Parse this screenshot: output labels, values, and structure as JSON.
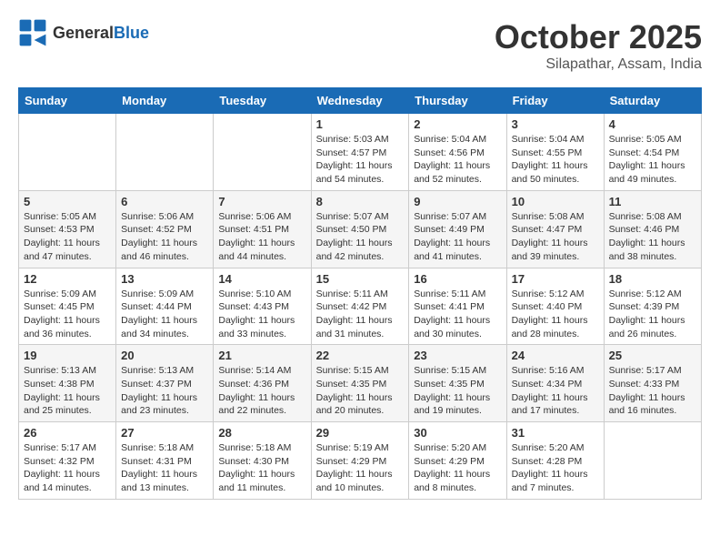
{
  "header": {
    "logo_general": "General",
    "logo_blue": "Blue",
    "month": "October 2025",
    "location": "Silapathar, Assam, India"
  },
  "weekdays": [
    "Sunday",
    "Monday",
    "Tuesday",
    "Wednesday",
    "Thursday",
    "Friday",
    "Saturday"
  ],
  "weeks": [
    [
      {
        "day": "",
        "info": ""
      },
      {
        "day": "",
        "info": ""
      },
      {
        "day": "",
        "info": ""
      },
      {
        "day": "1",
        "info": "Sunrise: 5:03 AM\nSunset: 4:57 PM\nDaylight: 11 hours\nand 54 minutes."
      },
      {
        "day": "2",
        "info": "Sunrise: 5:04 AM\nSunset: 4:56 PM\nDaylight: 11 hours\nand 52 minutes."
      },
      {
        "day": "3",
        "info": "Sunrise: 5:04 AM\nSunset: 4:55 PM\nDaylight: 11 hours\nand 50 minutes."
      },
      {
        "day": "4",
        "info": "Sunrise: 5:05 AM\nSunset: 4:54 PM\nDaylight: 11 hours\nand 49 minutes."
      }
    ],
    [
      {
        "day": "5",
        "info": "Sunrise: 5:05 AM\nSunset: 4:53 PM\nDaylight: 11 hours\nand 47 minutes."
      },
      {
        "day": "6",
        "info": "Sunrise: 5:06 AM\nSunset: 4:52 PM\nDaylight: 11 hours\nand 46 minutes."
      },
      {
        "day": "7",
        "info": "Sunrise: 5:06 AM\nSunset: 4:51 PM\nDaylight: 11 hours\nand 44 minutes."
      },
      {
        "day": "8",
        "info": "Sunrise: 5:07 AM\nSunset: 4:50 PM\nDaylight: 11 hours\nand 42 minutes."
      },
      {
        "day": "9",
        "info": "Sunrise: 5:07 AM\nSunset: 4:49 PM\nDaylight: 11 hours\nand 41 minutes."
      },
      {
        "day": "10",
        "info": "Sunrise: 5:08 AM\nSunset: 4:47 PM\nDaylight: 11 hours\nand 39 minutes."
      },
      {
        "day": "11",
        "info": "Sunrise: 5:08 AM\nSunset: 4:46 PM\nDaylight: 11 hours\nand 38 minutes."
      }
    ],
    [
      {
        "day": "12",
        "info": "Sunrise: 5:09 AM\nSunset: 4:45 PM\nDaylight: 11 hours\nand 36 minutes."
      },
      {
        "day": "13",
        "info": "Sunrise: 5:09 AM\nSunset: 4:44 PM\nDaylight: 11 hours\nand 34 minutes."
      },
      {
        "day": "14",
        "info": "Sunrise: 5:10 AM\nSunset: 4:43 PM\nDaylight: 11 hours\nand 33 minutes."
      },
      {
        "day": "15",
        "info": "Sunrise: 5:11 AM\nSunset: 4:42 PM\nDaylight: 11 hours\nand 31 minutes."
      },
      {
        "day": "16",
        "info": "Sunrise: 5:11 AM\nSunset: 4:41 PM\nDaylight: 11 hours\nand 30 minutes."
      },
      {
        "day": "17",
        "info": "Sunrise: 5:12 AM\nSunset: 4:40 PM\nDaylight: 11 hours\nand 28 minutes."
      },
      {
        "day": "18",
        "info": "Sunrise: 5:12 AM\nSunset: 4:39 PM\nDaylight: 11 hours\nand 26 minutes."
      }
    ],
    [
      {
        "day": "19",
        "info": "Sunrise: 5:13 AM\nSunset: 4:38 PM\nDaylight: 11 hours\nand 25 minutes."
      },
      {
        "day": "20",
        "info": "Sunrise: 5:13 AM\nSunset: 4:37 PM\nDaylight: 11 hours\nand 23 minutes."
      },
      {
        "day": "21",
        "info": "Sunrise: 5:14 AM\nSunset: 4:36 PM\nDaylight: 11 hours\nand 22 minutes."
      },
      {
        "day": "22",
        "info": "Sunrise: 5:15 AM\nSunset: 4:35 PM\nDaylight: 11 hours\nand 20 minutes."
      },
      {
        "day": "23",
        "info": "Sunrise: 5:15 AM\nSunset: 4:35 PM\nDaylight: 11 hours\nand 19 minutes."
      },
      {
        "day": "24",
        "info": "Sunrise: 5:16 AM\nSunset: 4:34 PM\nDaylight: 11 hours\nand 17 minutes."
      },
      {
        "day": "25",
        "info": "Sunrise: 5:17 AM\nSunset: 4:33 PM\nDaylight: 11 hours\nand 16 minutes."
      }
    ],
    [
      {
        "day": "26",
        "info": "Sunrise: 5:17 AM\nSunset: 4:32 PM\nDaylight: 11 hours\nand 14 minutes."
      },
      {
        "day": "27",
        "info": "Sunrise: 5:18 AM\nSunset: 4:31 PM\nDaylight: 11 hours\nand 13 minutes."
      },
      {
        "day": "28",
        "info": "Sunrise: 5:18 AM\nSunset: 4:30 PM\nDaylight: 11 hours\nand 11 minutes."
      },
      {
        "day": "29",
        "info": "Sunrise: 5:19 AM\nSunset: 4:29 PM\nDaylight: 11 hours\nand 10 minutes."
      },
      {
        "day": "30",
        "info": "Sunrise: 5:20 AM\nSunset: 4:29 PM\nDaylight: 11 hours\nand 8 minutes."
      },
      {
        "day": "31",
        "info": "Sunrise: 5:20 AM\nSunset: 4:28 PM\nDaylight: 11 hours\nand 7 minutes."
      },
      {
        "day": "",
        "info": ""
      }
    ]
  ]
}
